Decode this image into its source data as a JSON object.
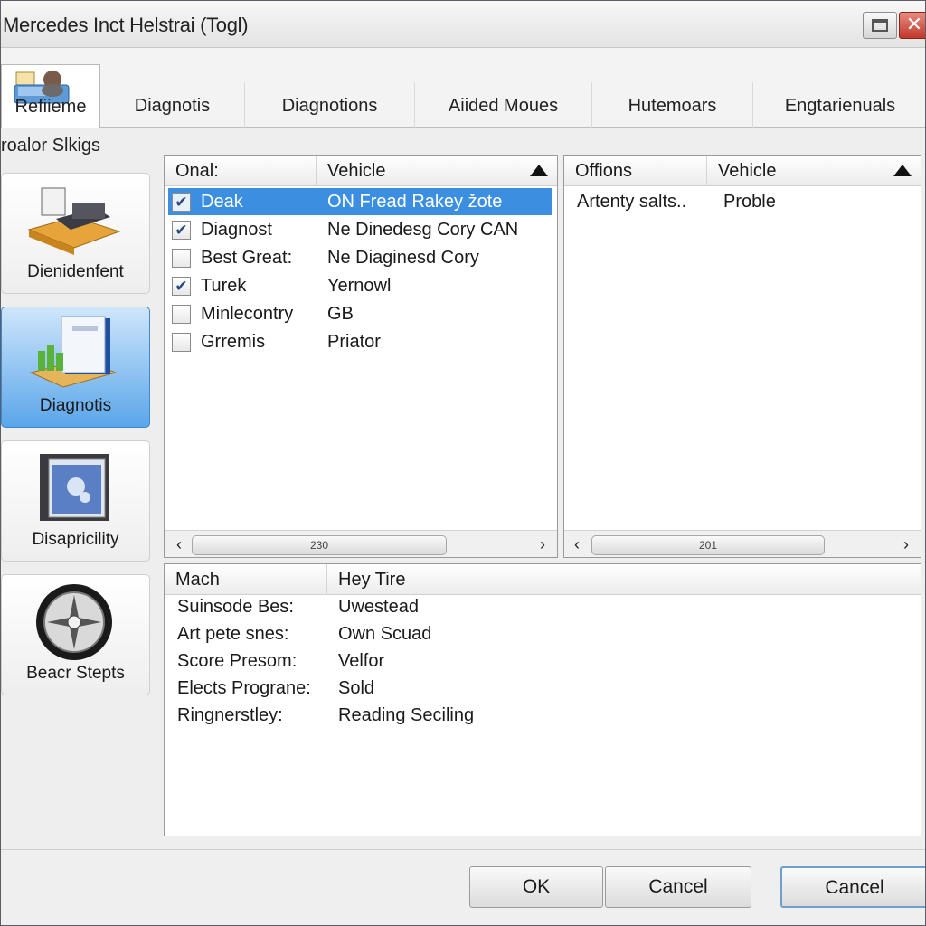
{
  "window": {
    "title": "Mercedes Inct Helstrai (Togl)",
    "close_glyph": "✕"
  },
  "tabs": [
    {
      "label": "Refiieme",
      "active": true,
      "icon": "diagnostic-folder-icon"
    },
    {
      "label": "Diagnotis"
    },
    {
      "label": "Diagnotions"
    },
    {
      "label": "Aiided Moues"
    },
    {
      "label": "Hutemoars"
    },
    {
      "label": "Engtarienuals"
    }
  ],
  "section_label": "roalor Slkigs",
  "nav": [
    {
      "label": "Dienidenfent",
      "icon": "workbench-icon"
    },
    {
      "label": "Diagnotis",
      "icon": "diagnostic-chart-icon",
      "selected": true
    },
    {
      "label": "Disapricility",
      "icon": "display-panel-icon"
    },
    {
      "label": "Beacr Stepts",
      "icon": "brand-emblem-icon"
    }
  ],
  "left_list": {
    "columns": [
      "Onal:",
      "Vehicle"
    ],
    "rows": [
      {
        "name": "Deak",
        "vehicle": "ON Fread Rakey žote",
        "checked": true,
        "selected": true
      },
      {
        "name": "Diagnost",
        "vehicle": "Ne Dinedesg Cory CAN",
        "checked": true
      },
      {
        "name": "Best Great:",
        "vehicle": "Ne Diaginesd Cory",
        "checked": false
      },
      {
        "name": "Turek",
        "vehicle": "Yernowl",
        "checked": true
      },
      {
        "name": "Minlecontry",
        "vehicle": "GB",
        "checked": false
      },
      {
        "name": "Grremis",
        "vehicle": "Priator",
        "checked": false
      }
    ],
    "scroll_label": "230"
  },
  "right_list": {
    "columns": [
      "Offions",
      "Vehicle"
    ],
    "rows": [
      {
        "name": "Artenty salts..",
        "vehicle": "Proble"
      }
    ],
    "scroll_label": "201"
  },
  "details": {
    "columns": [
      "Mach",
      "Hey Tire"
    ],
    "rows": [
      {
        "label": "Suinsode Bes:",
        "value": "Uwestead"
      },
      {
        "label": "Art pete snes:",
        "value": "Own Scuad"
      },
      {
        "label": "Score Presom:",
        "value": "Velfor"
      },
      {
        "label": "Elects Prograne:",
        "value": "Sold"
      },
      {
        "label": "Ringnerstley:",
        "value": "Reading Seciling"
      }
    ]
  },
  "buttons": {
    "ok": "OK",
    "cancel1": "Cancel",
    "cancel2": "Cancel"
  },
  "glyphs": {
    "check": "✔",
    "left_arrow": "‹",
    "right_arrow": "›"
  },
  "colors": {
    "selection": "#3b8ee0",
    "nav_selected": "#5aa6ea"
  }
}
